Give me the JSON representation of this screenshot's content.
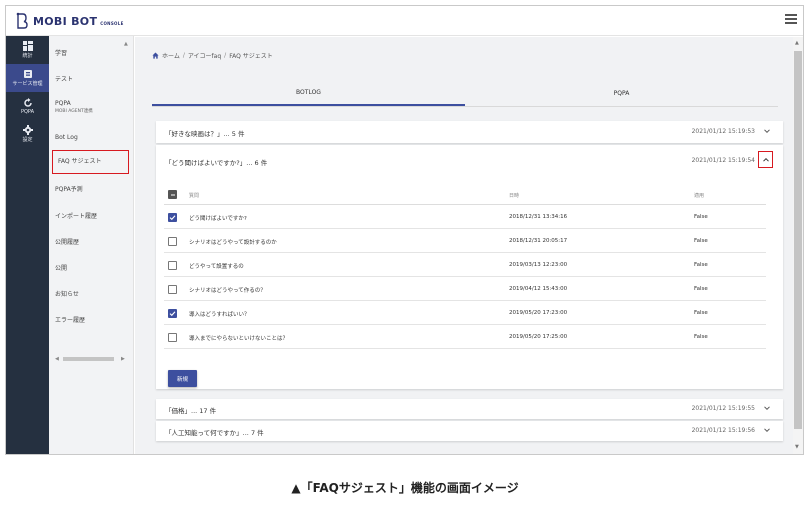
{
  "header": {
    "brand": "MOBI BOT",
    "brand_suffix": "CONSOLE",
    "menu_icon": "hamburger-icon"
  },
  "iconbar": {
    "items": [
      {
        "label": "統計",
        "icon": "dashboard-icon"
      },
      {
        "label": "サービス管理",
        "icon": "service-icon"
      },
      {
        "label": "PQPA",
        "icon": "refresh-icon"
      },
      {
        "label": "設定",
        "icon": "gear-icon"
      }
    ]
  },
  "sidebar": {
    "items": [
      {
        "label": "学習"
      },
      {
        "label": "テスト"
      },
      {
        "label": "PQPA",
        "sub": "MOBI AGENT連携"
      },
      {
        "label": "Bot Log"
      },
      {
        "label": "FAQ サジェスト"
      },
      {
        "label": "PQPA予測"
      },
      {
        "label": "インポート履歴"
      },
      {
        "label": "公開履歴"
      },
      {
        "label": "公開"
      },
      {
        "label": "お知らせ"
      },
      {
        "label": "エラー履歴"
      }
    ]
  },
  "breadcrumb": {
    "home": "ホーム",
    "sep": "/",
    "items": [
      "アイコーfaq",
      "FAQ サジェスト"
    ]
  },
  "tabs": [
    {
      "label": "BOTLOG"
    },
    {
      "label": "PQPA"
    }
  ],
  "panels": [
    {
      "title": "「好きな映画は？」... 5 件",
      "date": "2021/01/12 15:19:53"
    },
    {
      "title": "「どう聞けばよいですか?」... 6 件",
      "date": "2021/01/12 15:19:54"
    },
    {
      "title": "「価格」... 17 件",
      "date": "2021/01/12 15:19:55"
    },
    {
      "title": "「人工知能って何ですか」... 7 件",
      "date": "2021/01/12 15:19:56"
    }
  ],
  "table": {
    "headers": {
      "question": "質問",
      "date": "日時",
      "apply": "適用"
    },
    "rows": [
      {
        "question": "どう聞けばよいですか?",
        "date": "2018/12/31 13:34:16",
        "apply": "False",
        "checked": true
      },
      {
        "question": "シナリオはどうやって設計するのか",
        "date": "2018/12/31 20:05:17",
        "apply": "False",
        "checked": false
      },
      {
        "question": "どうやって設置するの",
        "date": "2019/03/13 12:23:00",
        "apply": "False",
        "checked": false
      },
      {
        "question": "シナリオはどうやって作るの？",
        "date": "2019/04/12 15:43:00",
        "apply": "False",
        "checked": false
      },
      {
        "question": "導入はどうすればいい？",
        "date": "2019/05/20 17:23:00",
        "apply": "False",
        "checked": true
      },
      {
        "question": "導入までにやらないといけないことは？",
        "date": "2019/05/20 17:25:00",
        "apply": "False",
        "checked": false
      }
    ]
  },
  "new_button": "新規",
  "caption": "▲「FAQサジェスト」機能の画面イメージ",
  "colors": {
    "accent": "#3d4f9f",
    "sidebar_dark": "#253040",
    "highlight": "#d71920"
  }
}
